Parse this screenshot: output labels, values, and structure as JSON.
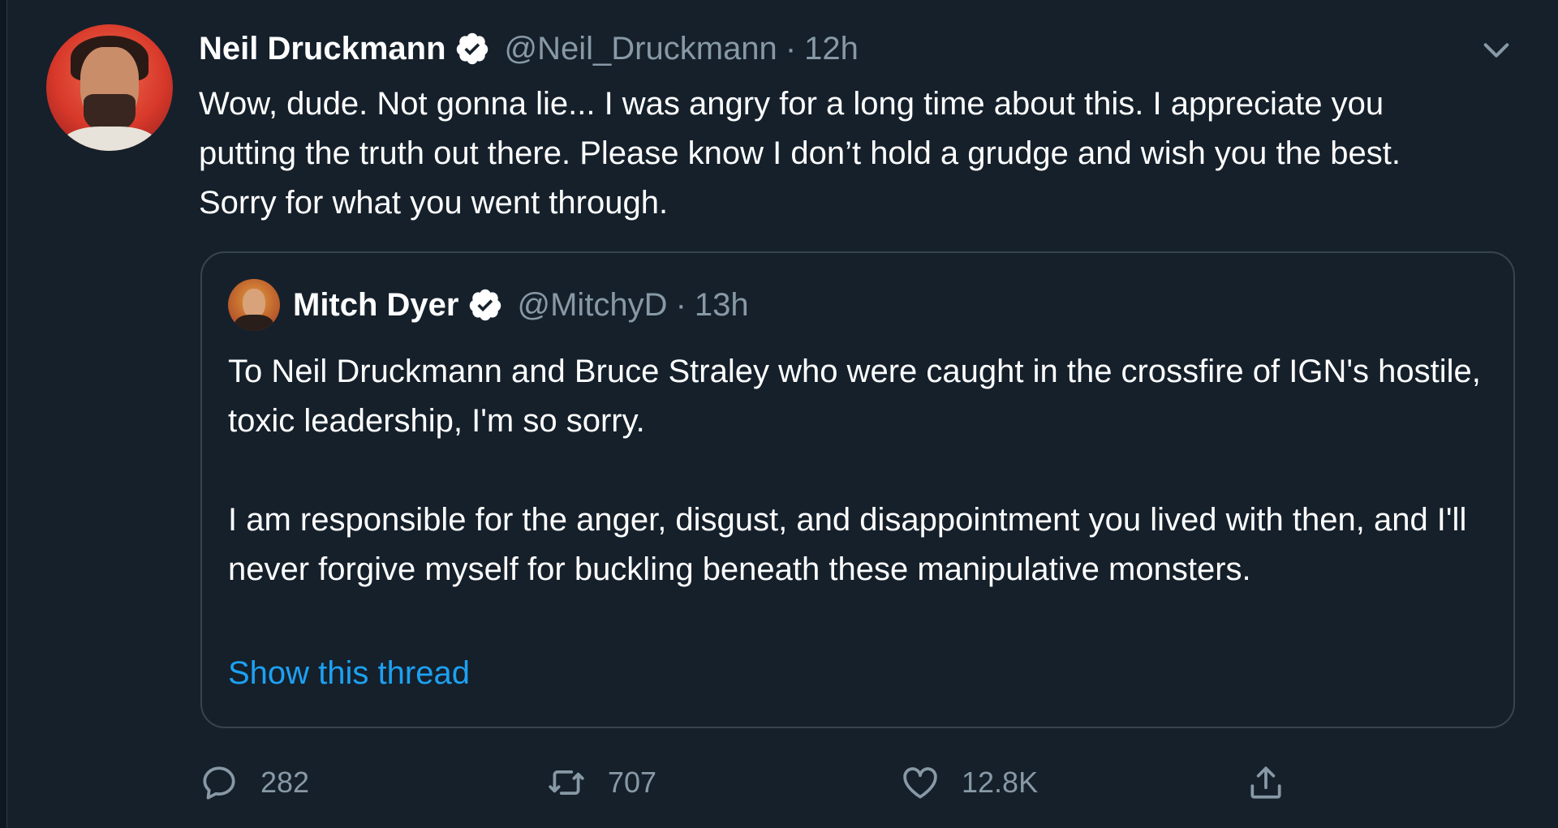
{
  "tweet": {
    "author": {
      "display_name": "Neil Druckmann",
      "handle": "@Neil_Druckmann",
      "verified": true
    },
    "separator": "·",
    "time": "12h",
    "text": "Wow, dude. Not gonna lie... I was angry for a long time about this. I appreciate you putting the truth out there. Please know I don’t hold a grudge and wish you the best. Sorry for what you went through.",
    "quoted_tweet": {
      "author": {
        "display_name": "Mitch Dyer",
        "handle": "@MitchyD",
        "verified": true
      },
      "separator": "·",
      "time": "13h",
      "paragraphs": [
        "To Neil Druckmann and Bruce Straley who were caught in the crossfire of IGN's hostile, toxic leadership, I'm so sorry.",
        "I am responsible for the anger, disgust, and disappointment you lived with then, and I'll never forgive myself for buckling beneath these manipulative monsters."
      ],
      "show_thread_label": "Show this thread"
    },
    "actions": {
      "reply_count": "282",
      "retweet_count": "707",
      "like_count": "12.8K"
    },
    "icons": {
      "verified": "verified-badge-icon",
      "menu": "chevron-down-icon",
      "reply": "reply-icon",
      "retweet": "retweet-icon",
      "like": "heart-icon",
      "share": "share-icon"
    },
    "colors": {
      "background": "#15202b",
      "text": "#ffffff",
      "muted": "#8899a6",
      "link": "#1da1f2",
      "border": "#38444d"
    }
  }
}
